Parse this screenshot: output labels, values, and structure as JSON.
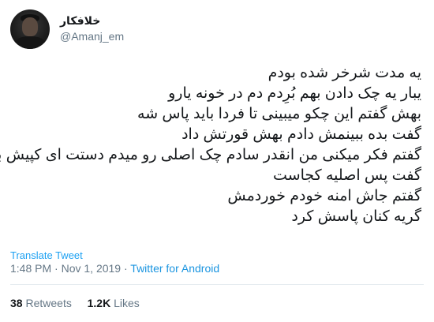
{
  "author": {
    "display_name": "خلافکار",
    "handle": "@Amanj_em"
  },
  "tweet": {
    "lines": [
      "یه مدت شرخر شده بودم",
      "یبار یه چک دادن بهم بُرِدم دم در خونه یارو",
      "بهش گفتم این چکو میبینی تا فردا باید پاس شه",
      "گفت بده ببینمش دادم بهش قورتش داد",
      "گفتم فکر میکنی من انقدر سادم چک اصلی رو میدم دستت ای کپیش بود",
      "گفت پس اصلیه کجاست",
      "گفتم جاش امنه خودم خوردمش",
      "گریه کنان پاسش کرد"
    ]
  },
  "translate_label": "Translate Tweet",
  "meta": {
    "time": "1:48 PM",
    "separator": "·",
    "date": "Nov 1, 2019",
    "source": "Twitter for Android"
  },
  "stats": {
    "retweets_count": "38",
    "retweets_label": "Retweets",
    "likes_count": "1.2K",
    "likes_label": "Likes"
  }
}
